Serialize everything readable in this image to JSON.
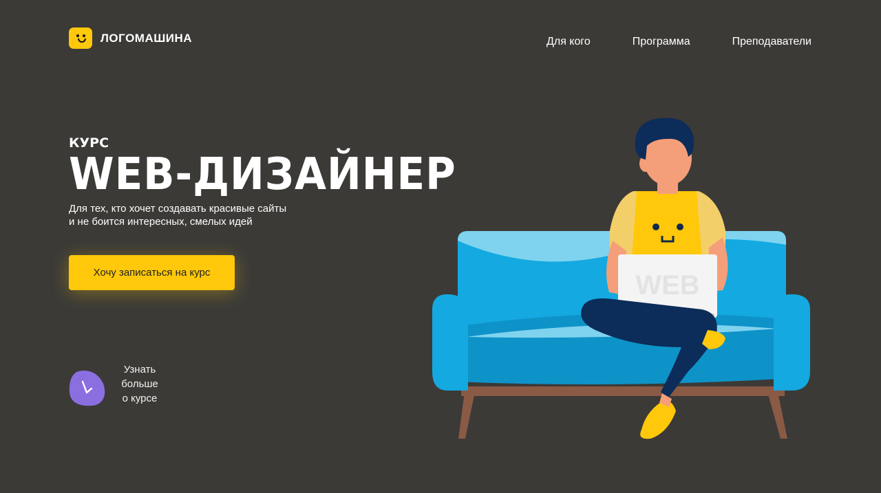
{
  "header": {
    "logo_text": "ЛОГОМАШИНА",
    "nav": [
      "Для кого",
      "Программа",
      "Преподаватели"
    ]
  },
  "hero": {
    "kicker": "КУРС",
    "title": "WEB-ДИЗАЙНЕР",
    "subtitle_line1": "Для тех, кто хочет создавать красивые сайты",
    "subtitle_line2": "и не боится интересных, смелых идей",
    "cta_label": "Хочу записаться на курс",
    "more_line1": "Узнать больше",
    "more_line2": "о курсе"
  },
  "illustration": {
    "laptop_text": "WEB"
  },
  "colors": {
    "background": "#3b3a37",
    "accent_yellow": "#ffc80a",
    "sofa_blue": "#14a9e0",
    "blob_purple": "#8b6fe0"
  },
  "icons": [
    "logo-face-icon",
    "arrow-down-right-icon"
  ]
}
